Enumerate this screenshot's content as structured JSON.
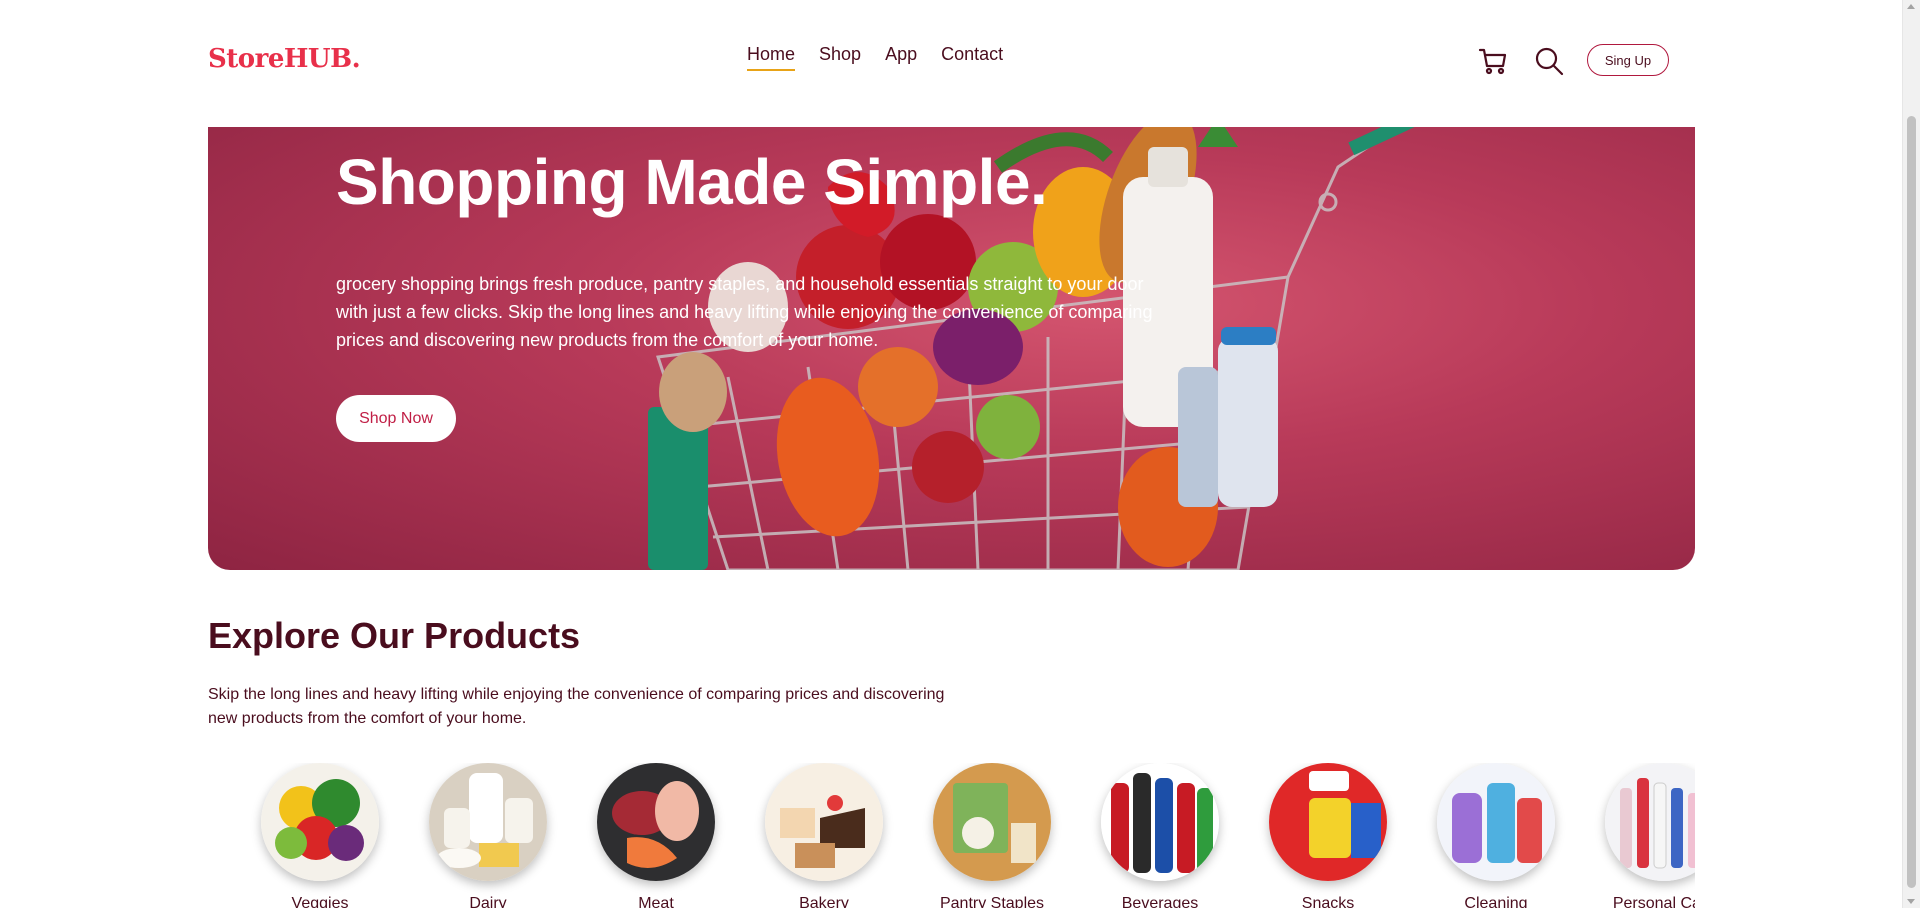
{
  "header": {
    "logo_text": "StoreHUB",
    "logo_dot": ".",
    "nav": [
      {
        "label": "Home",
        "active": true
      },
      {
        "label": "Shop",
        "active": false
      },
      {
        "label": "App",
        "active": false
      },
      {
        "label": "Contact",
        "active": false
      }
    ],
    "cart_icon": "cart-icon",
    "search_icon": "search-icon",
    "signup_label": "Sing Up"
  },
  "hero": {
    "title": "Shopping Made Simple.",
    "description": "grocery shopping brings fresh produce, pantry staples, and household essentials straight to your door with just a few clicks. Skip the long lines and heavy lifting while enjoying the convenience of comparing prices and discovering new products from the comfort of your home.",
    "cta_label": "Shop Now"
  },
  "explore": {
    "title": "Explore Our Products",
    "description": "Skip the long lines and heavy lifting while enjoying the convenience of comparing prices and discovering new products from the comfort of your home.",
    "categories": [
      {
        "label": "Veggies",
        "color": "#6aa83a"
      },
      {
        "label": "Dairy",
        "color": "#e8e2d4"
      },
      {
        "label": "Meat",
        "color": "#3c3c3c"
      },
      {
        "label": "Bakery",
        "color": "#d9a66a"
      },
      {
        "label": "Pantry Staples",
        "color": "#c99a4e"
      },
      {
        "label": "Beverages",
        "color": "#b8202c"
      },
      {
        "label": "Snacks",
        "color": "#e02828"
      },
      {
        "label": "Cleaning",
        "color": "#8f8fd0"
      },
      {
        "label": "Personal Care",
        "color": "#d8dbe8"
      }
    ]
  },
  "colors": {
    "brand": "#e8304a",
    "text": "#4a0d1e",
    "accent_underline": "#e8a317",
    "hero_bg": "#b83a59"
  }
}
